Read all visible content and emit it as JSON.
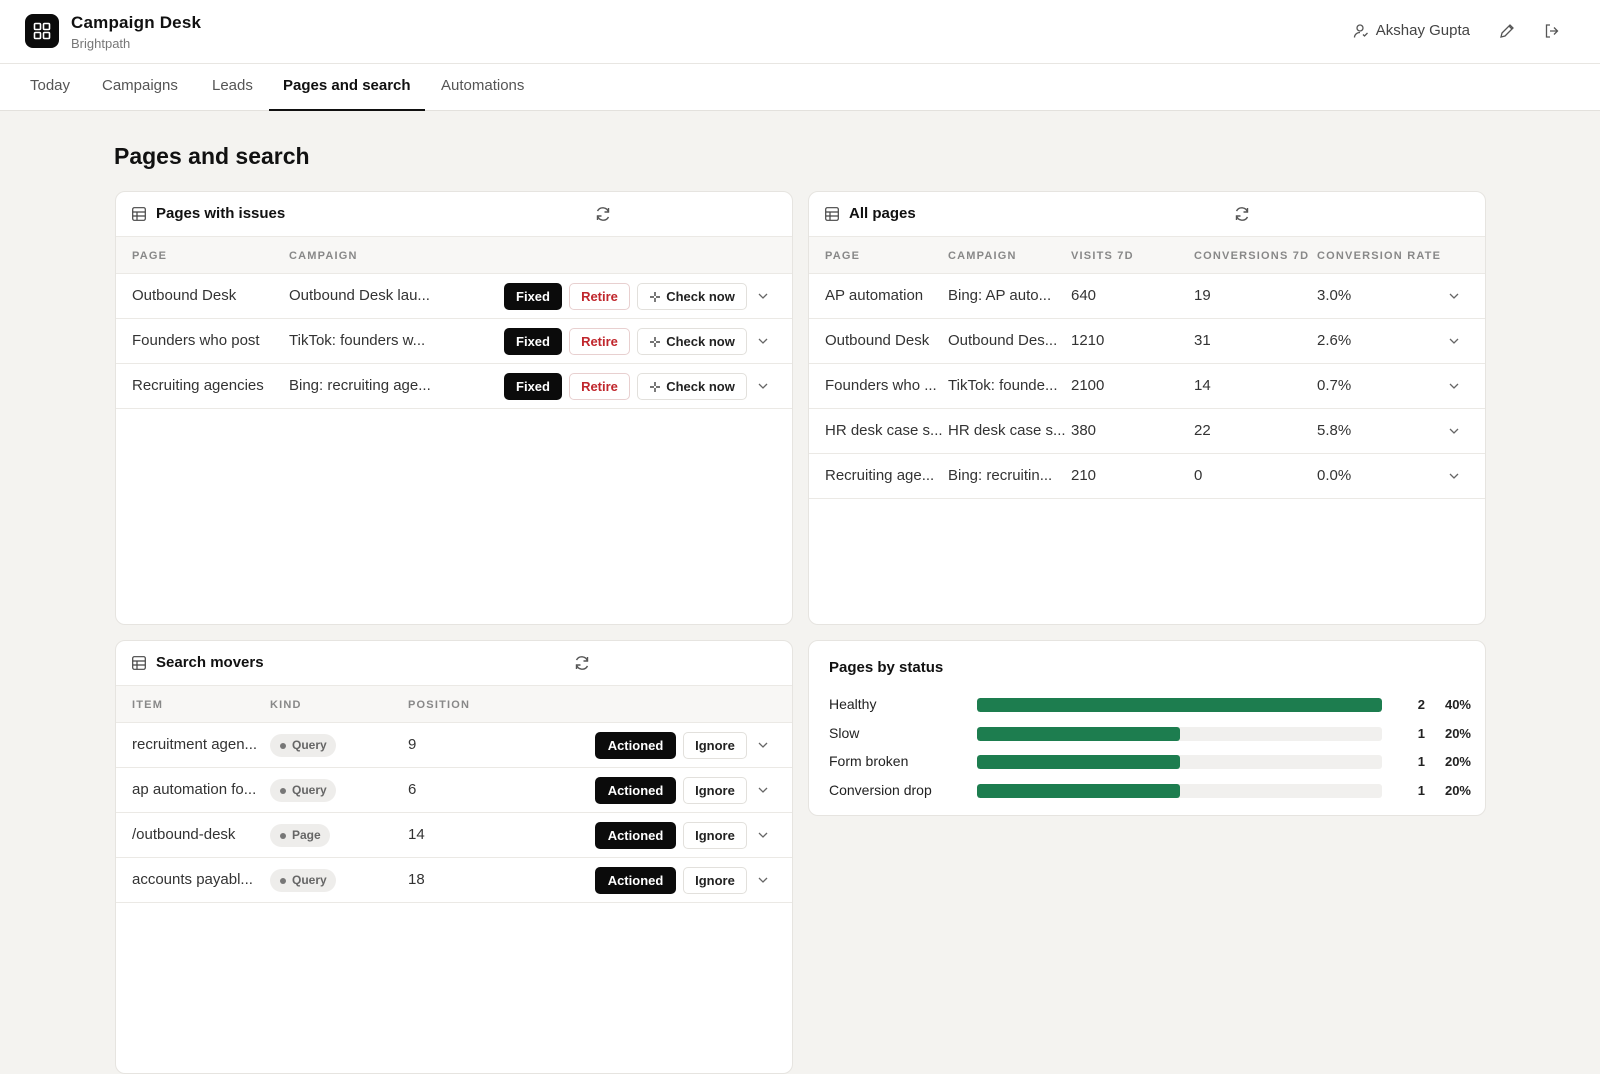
{
  "header": {
    "app_title": "Campaign Desk",
    "app_subtitle": "Brightpath",
    "user_name": "Akshay Gupta"
  },
  "tabs": [
    {
      "label": "Today"
    },
    {
      "label": "Campaigns"
    },
    {
      "label": "Leads"
    },
    {
      "label": "Pages and search",
      "active": true
    },
    {
      "label": "Automations"
    }
  ],
  "page_title": "Pages and search",
  "issues": {
    "title": "Pages with issues",
    "columns": [
      "PAGE",
      "CAMPAIGN"
    ],
    "fixed_label": "Fixed",
    "retire_label": "Retire",
    "check_label": "Check now",
    "rows": [
      {
        "page": "Outbound Desk",
        "campaign": "Outbound Desk lau..."
      },
      {
        "page": "Founders who post",
        "campaign": "TikTok: founders w..."
      },
      {
        "page": "Recruiting agencies",
        "campaign": "Bing: recruiting age..."
      }
    ]
  },
  "all_pages": {
    "title": "All pages",
    "columns": [
      "PAGE",
      "CAMPAIGN",
      "VISITS 7D",
      "CONVERSIONS 7D",
      "CONVERSION RATE"
    ],
    "rows": [
      {
        "page": "AP automation",
        "campaign": "Bing: AP auto...",
        "visits": "640",
        "conversions": "19",
        "rate": "3.0%"
      },
      {
        "page": "Outbound Desk",
        "campaign": "Outbound Des...",
        "visits": "1210",
        "conversions": "31",
        "rate": "2.6%"
      },
      {
        "page": "Founders who ...",
        "campaign": "TikTok: founde...",
        "visits": "2100",
        "conversions": "14",
        "rate": "0.7%"
      },
      {
        "page": "HR desk case s...",
        "campaign": "HR desk case s...",
        "visits": "380",
        "conversions": "22",
        "rate": "5.8%"
      },
      {
        "page": "Recruiting age...",
        "campaign": "Bing: recruitin...",
        "visits": "210",
        "conversions": "0",
        "rate": "0.0%"
      }
    ]
  },
  "search_movers": {
    "title": "Search movers",
    "columns": [
      "ITEM",
      "KIND",
      "POSITION"
    ],
    "actioned_label": "Actioned",
    "ignore_label": "Ignore",
    "rows": [
      {
        "item": "recruitment agen...",
        "kind": "Query",
        "position": "9"
      },
      {
        "item": "ap automation fo...",
        "kind": "Query",
        "position": "6"
      },
      {
        "item": "/outbound-desk",
        "kind": "Page",
        "position": "14"
      },
      {
        "item": "accounts payabl...",
        "kind": "Query",
        "position": "18"
      }
    ]
  },
  "status": {
    "title": "Pages by status",
    "accent": "#1d7d4f",
    "rows": [
      {
        "label": "Healthy",
        "count": "2",
        "pct": "40%",
        "fill": 1.0
      },
      {
        "label": "Slow",
        "count": "1",
        "pct": "20%",
        "fill": 0.5
      },
      {
        "label": "Form broken",
        "count": "1",
        "pct": "20%",
        "fill": 0.5
      },
      {
        "label": "Conversion drop",
        "count": "1",
        "pct": "20%",
        "fill": 0.5
      }
    ]
  }
}
